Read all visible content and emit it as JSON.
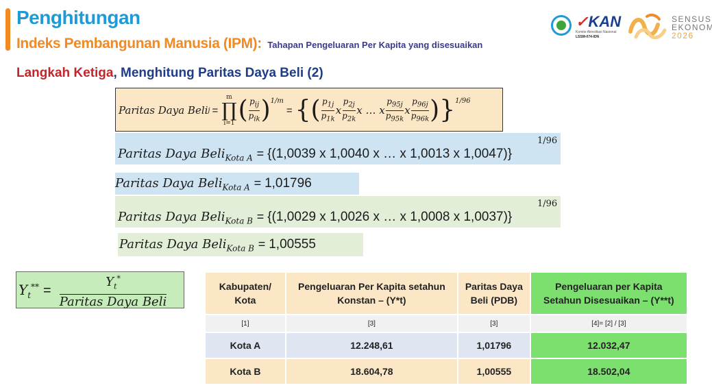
{
  "header": {
    "title": "Penghitungan",
    "subtitle": "Indeks Pembangunan Manusia (IPM):",
    "subtitle_detail": "Tahapan Pengeluaran Per Kapita yang disesuaikan"
  },
  "logos": {
    "kan_text": "KAN",
    "kan_sub1": "Komite Akreditasi Nasional",
    "kan_sub2": "LSSM-074-IDN",
    "se_line1": "SENSUS",
    "se_line2": "EKONOMI",
    "se_year": "2026"
  },
  "step": {
    "red_label": "Langkah Ketiga",
    "rest_label": ", Menghitung Paritas Daya Beli (2)"
  },
  "formulas": {
    "main_lhs": "Paritas Daya Beli",
    "main_lhs_sub": "j",
    "kota_a_label": "Paritas Daya Beli",
    "kota_a_sub": "Kota A",
    "kota_a_expr": "{(1,0039 x 1,0040 x … x 1,0013 x 1,0047)}",
    "kota_a_result": "1,01796",
    "kota_b_label": "Paritas Daya Beli",
    "kota_b_sub": "Kota B",
    "kota_b_expr": "{(1,0029 x 1,0026 x … x 1,0008 x 1,0037)}",
    "kota_b_result": "1,00555",
    "exponent": "1/96",
    "y_denominator": "Paritas Daya Beli"
  },
  "table": {
    "headers": [
      "Kabupaten/ Kota",
      "Pengeluaran Per Kapita setahun Konstan – (Y*t)",
      "Paritas Daya Beli (PDB)",
      "Pengeluaran per Kapita Setahun Disesuaikan – (Y**t)"
    ],
    "index_row": [
      "[1]",
      "[3]",
      "[3]",
      "[4]= [2] / [3]"
    ],
    "rows": [
      [
        "Kota A",
        "12.248,61",
        "1,01796",
        "12.032,47"
      ],
      [
        "Kota B",
        "18.604,78",
        "1,00555",
        "18.502,04"
      ]
    ]
  }
}
